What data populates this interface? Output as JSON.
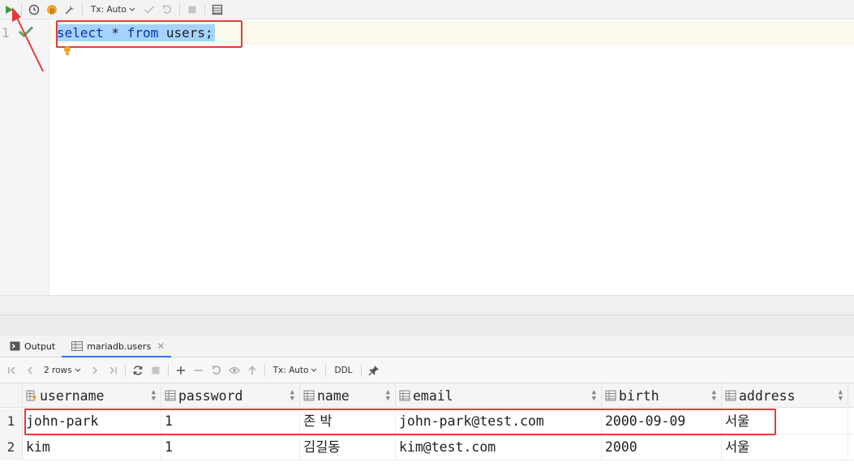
{
  "toolbar": {
    "tx_mode": "Tx: Auto"
  },
  "editor": {
    "line_number": "1",
    "query": {
      "kw1": "select",
      "sp1": " * ",
      "kw2": "from",
      "sp2": " users;"
    }
  },
  "tabs": [
    {
      "label": "Output"
    },
    {
      "label": "mariadb.users"
    }
  ],
  "result_toolbar": {
    "rows_label": "2 rows",
    "tx_mode": "Tx: Auto",
    "ddl_label": "DDL"
  },
  "grid": {
    "columns": [
      "username",
      "password",
      "name",
      "email",
      "birth",
      "address"
    ],
    "rows": [
      {
        "num": "1",
        "cells": [
          "john-park",
          "1",
          "존 박",
          "john-park@test.com",
          "2000-09-09",
          "서울"
        ]
      },
      {
        "num": "2",
        "cells": [
          "kim",
          "1",
          "김길동",
          "kim@test.com",
          "2000",
          "서울"
        ]
      }
    ]
  },
  "colors": {
    "accent": "#3574f0",
    "highlight_box": "#e33a3a",
    "run_green": "#3d9a3d",
    "selection": "#a6d2ff"
  }
}
